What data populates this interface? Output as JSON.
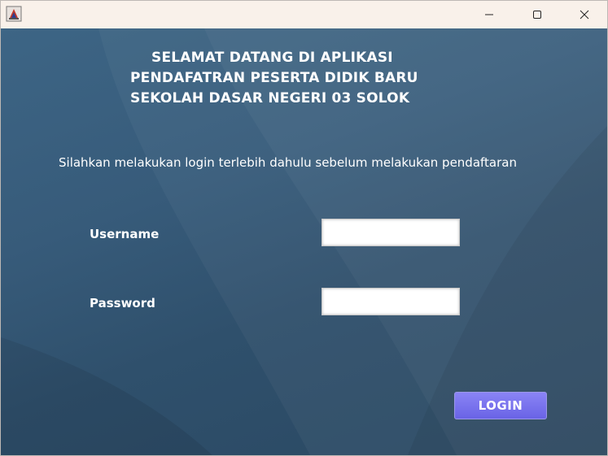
{
  "window": {
    "app_icon": "java-cup-icon",
    "controls": [
      "minimize-icon",
      "maximize-icon",
      "close-icon"
    ]
  },
  "header": {
    "line1": "SELAMAT DATANG DI APLIKASI",
    "line2": "PENDAFATRAN PESERTA DIDIK BARU",
    "line3": "SEKOLAH DASAR NEGERI 03 SOLOK"
  },
  "subtitle": "Silahkan melakukan login terlebih dahulu sebelum melakukan pendaftaran",
  "form": {
    "username_label": "Username",
    "username_value": "",
    "password_label": "Password",
    "password_value": "",
    "login_label": "LOGIN"
  },
  "colors": {
    "background": "#375b7a",
    "button": "#7872ee",
    "text": "#ffffff"
  }
}
